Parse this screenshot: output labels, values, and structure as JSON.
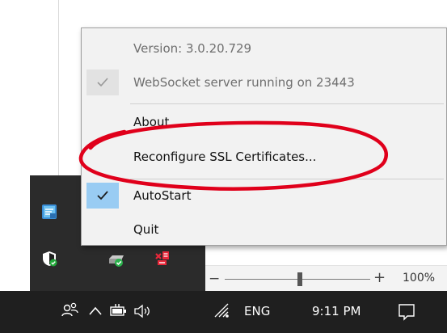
{
  "menu": {
    "items": [
      {
        "label": "Version: 3.0.20.729",
        "enabled": false,
        "checked": false
      },
      {
        "label": "WebSocket server running on 23443",
        "enabled": false,
        "checked": true
      },
      {
        "label": "About",
        "enabled": true,
        "checked": false
      },
      {
        "label": "Reconfigure SSL Certificates...",
        "enabled": true,
        "checked": false
      },
      {
        "label": "AutoStart",
        "enabled": true,
        "checked": true
      },
      {
        "label": "Quit",
        "enabled": true,
        "checked": false
      }
    ]
  },
  "zoom": {
    "minus": "−",
    "plus": "+",
    "level_label": "100%",
    "level_fraction": 0.5
  },
  "tray_icons": [
    "websocket-app-icon",
    "windows-defender-icon",
    "drive-check-icon",
    "network-error-icon"
  ],
  "taskbar": {
    "people_icon": "people-icon",
    "show_hidden_icon": "chevron-up-icon",
    "battery_icon": "battery-icon",
    "volume_icon": "volume-icon",
    "wifi_icon": "wifi-icon",
    "language": "ENG",
    "time": "9:11 PM",
    "notification_icon": "action-center-icon"
  },
  "colors": {
    "annotation": "#e0001b",
    "checked_bg": "#99ccf3",
    "taskbar_bg": "#1f1f1f"
  }
}
